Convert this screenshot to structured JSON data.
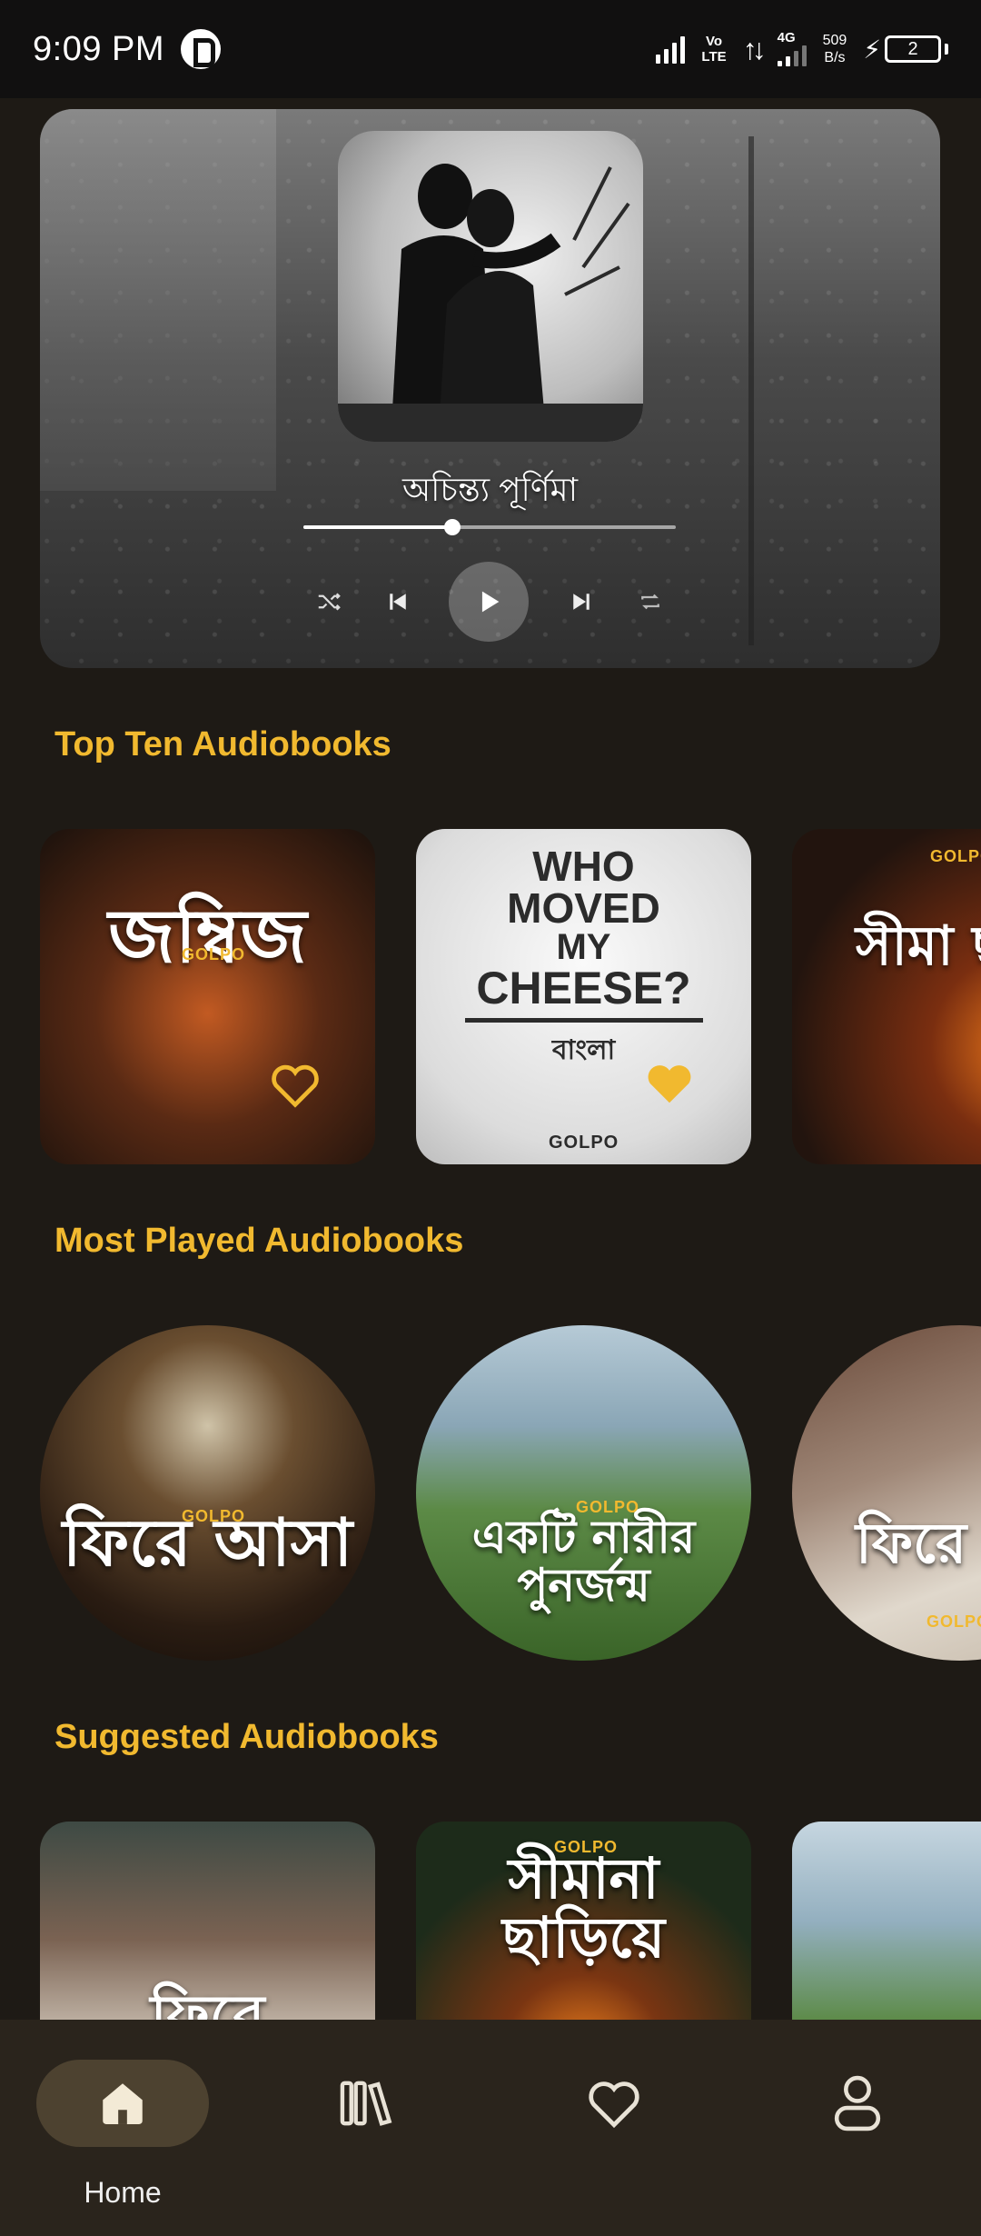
{
  "status_bar": {
    "time": "9:09 PM",
    "app_icon": "pocket-notification-icon",
    "volte_top": "Vo",
    "volte_bottom": "LTE",
    "network_type": "4G",
    "net_speed_value": "509",
    "net_speed_unit": "B/s",
    "battery_level": "2"
  },
  "player": {
    "title": "অচিন্ত্য পূর্ণিমা",
    "progress": 0.4,
    "controls": {
      "shuffle_icon": "shuffle-icon",
      "previous_icon": "skip-previous-icon",
      "play_icon": "play-icon",
      "next_icon": "skip-next-icon",
      "repeat_icon": "repeat-icon"
    }
  },
  "sections": {
    "top_ten": {
      "title": "Top Ten Audiobooks",
      "items": [
        {
          "cover_text": "জম্বিজ",
          "brand": "GOLPO",
          "favorited": false,
          "colors": [
            "#2a1a12",
            "#a5481e"
          ]
        },
        {
          "cover_lines": [
            "WHO",
            "MOVED",
            "MY",
            "CHEESE?"
          ],
          "subtitle": "বাংলা",
          "brand": "GOLPO",
          "favorited": true,
          "colors": [
            "#f2f2f2",
            "#c9c9c9"
          ]
        },
        {
          "cover_text": "সীমা ছাড়ি",
          "brand": "GOLPO",
          "colors": [
            "#2b1610",
            "#6a2c12"
          ]
        }
      ]
    },
    "most_played": {
      "title": "Most Played Audiobooks",
      "items": [
        {
          "cover_text": "ফিরে আসা",
          "brand": "GOLPO",
          "colors": [
            "#3a2a1a",
            "#120c08"
          ]
        },
        {
          "cover_text": "একটি নারীর পুনর্জন্ম",
          "brand": "GOLPO",
          "colors": [
            "#8fb0c6",
            "#3e6a2c"
          ]
        },
        {
          "cover_text": "ফিরে পাও",
          "brand": "GOLPO",
          "colors": [
            "#7c5a46",
            "#d8d0c4"
          ]
        }
      ]
    },
    "suggested": {
      "title": "Suggested Audiobooks",
      "items": [
        {
          "cover_text": "ফিরে",
          "colors": [
            "#6e5a4c",
            "#e6dcd0"
          ]
        },
        {
          "cover_text": "সীমানা ছাড়িয়ে",
          "brand": "GOLPO",
          "colors": [
            "#1d2b1a",
            "#7a3512"
          ]
        },
        {
          "cover_text": "",
          "colors": [
            "#8fb0c6",
            "#3e6a2c"
          ]
        }
      ]
    }
  },
  "bottom_nav": {
    "items": [
      {
        "label": "Home",
        "icon": "home-icon",
        "active": true
      },
      {
        "label": "",
        "icon": "library-icon",
        "active": false
      },
      {
        "label": "",
        "icon": "heart-icon",
        "active": false
      },
      {
        "label": "",
        "icon": "profile-icon",
        "active": false
      }
    ]
  },
  "colors": {
    "background": "#1e1a15",
    "accent": "#f1b92f",
    "nav_background": "#2a241c",
    "nav_pill": "#4d4230"
  }
}
